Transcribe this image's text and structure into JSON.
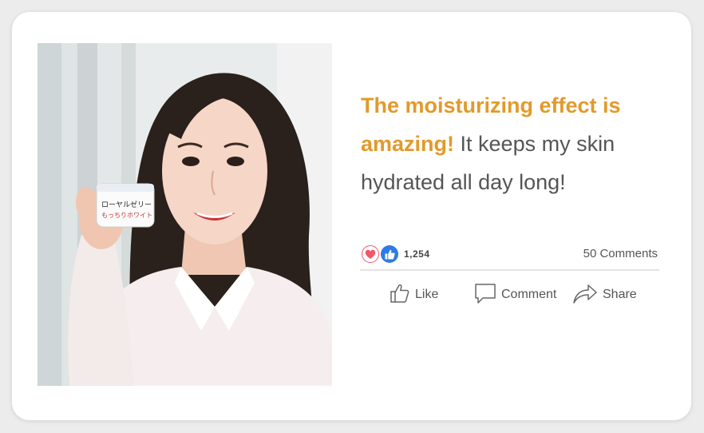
{
  "post": {
    "quote_highlight": "The moisturizing effect is amazing!",
    "quote_rest": " It keeps my skin hydrated all day long!",
    "highlight_color": "#e29a2b",
    "photo_product_text": "ローヤルゼリー もっちりホワイト"
  },
  "reactions": {
    "icons": [
      "heart-icon",
      "thumbs-up-icon"
    ],
    "count": "1,254",
    "comments": "50 Comments"
  },
  "actions": {
    "like_label": "Like",
    "comment_label": "Comment",
    "share_label": "Share"
  }
}
